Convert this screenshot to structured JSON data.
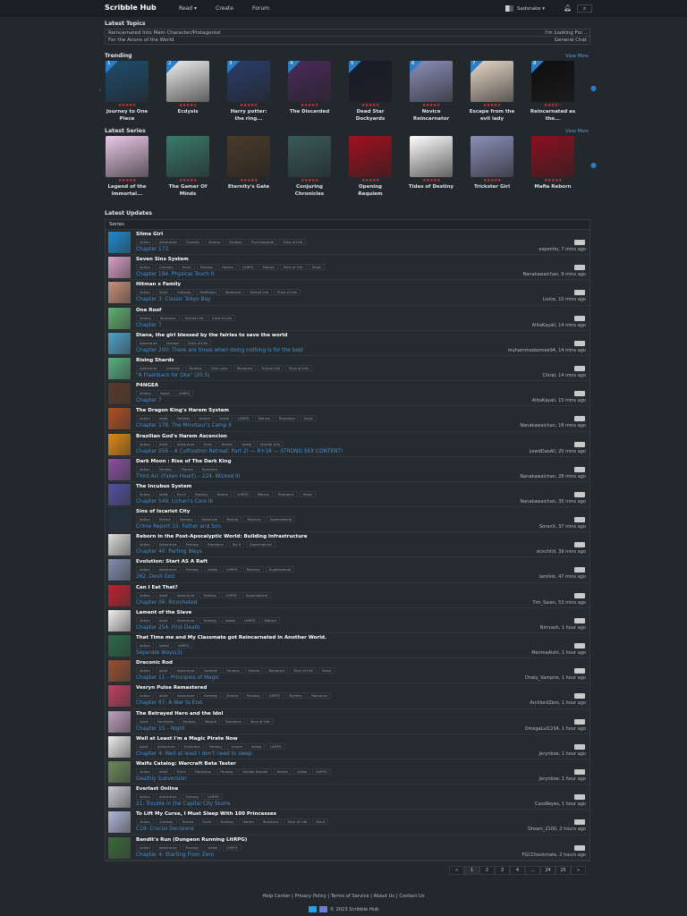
{
  "nav": {
    "brand": "Scribble Hub",
    "read": "Read ▾",
    "create": "Create",
    "forum": "Forum",
    "username": "Sadsnake ▾"
  },
  "latest_topics": {
    "label": "Latest Topics",
    "items": [
      {
        "title": "Reincarnated Into Main Character/Protagonist",
        "forum": "I'm Looking For..."
      },
      {
        "title": "For the Anons of the World",
        "forum": "General Chat"
      }
    ]
  },
  "trending": {
    "label": "Trending",
    "view_more": "View More",
    "items": [
      {
        "rank": "1",
        "title": "Journey to One Piece",
        "rating": 4.5
      },
      {
        "rank": "2",
        "title": "Ecdysis",
        "rating": 4.5
      },
      {
        "rank": "3",
        "title": "Harry potter: the ring...",
        "rating": 4.5
      },
      {
        "rank": "4",
        "title": "The Discarded",
        "rating": 4.5
      },
      {
        "rank": "5",
        "title": "Dead Star Dockyards",
        "rating": 4.5
      },
      {
        "rank": "6",
        "title": "Novice Reincarnator",
        "rating": 4.5
      },
      {
        "rank": "7",
        "title": "Escape from the evil lady",
        "rating": 4.5
      },
      {
        "rank": "8",
        "title": "Reincarnated as the...",
        "rating": 3.5
      }
    ]
  },
  "latest_series": {
    "label": "Latest Series",
    "view_more": "View More",
    "items": [
      {
        "title": "Legend of the Immortal...",
        "rating": 5
      },
      {
        "title": "The Gamer Of Minds",
        "rating": 5
      },
      {
        "title": "Eternity's Gate",
        "rating": 5
      },
      {
        "title": "Conjuring Chronicles",
        "rating": 5
      },
      {
        "title": "Opening Requiem",
        "rating": 5
      },
      {
        "title": "Tides of Destiny",
        "rating": 5
      },
      {
        "title": "Trickster Girl",
        "rating": 5
      },
      {
        "title": "Mafia Reborn",
        "rating": 5
      }
    ]
  },
  "updates": {
    "label": "Latest Updates",
    "header": "Series",
    "rows": [
      {
        "title": "Slime Girl",
        "tags": [
          "Action",
          "Adventure",
          "Comedy",
          "Drama",
          "Fantasy",
          "Psychological",
          "Slice of Life"
        ],
        "chapter": "Chapter 173",
        "meta": "expentio, 7 mins ago"
      },
      {
        "title": "Seven Sins System",
        "tags": [
          "Action",
          "Comedy",
          "Ecchi",
          "Fantasy",
          "Harem",
          "LitRPG",
          "Mature",
          "Slice of Life",
          "Smut"
        ],
        "chapter": "Chapter 194. Physical Touch II",
        "meta": "Nanakawaichan, 9 mins ago"
      },
      {
        "title": "Hitman x Family",
        "tags": [
          "Action",
          "Adult",
          "Comedy",
          "Fanfiction",
          "Romance",
          "School Life",
          "Slice of Life"
        ],
        "chapter": "Chapter 3: Classic Tokyo Bay",
        "meta": "Livice, 10 mins ago"
      },
      {
        "title": "One Roof",
        "tags": [
          "Drama",
          "Romance",
          "School Life",
          "Slice of Life"
        ],
        "chapter": "Chapter 7",
        "meta": "AlitaKayali, 14 mins ago"
      },
      {
        "title": "Diana, the girl blessed by the fairies to save the world",
        "tags": [
          "Adventure",
          "Fantasy",
          "Slice of Life"
        ],
        "chapter": "Chapter 200: There are times when doing nothing is for the best",
        "meta": "muhammadazmee94, 14 mins ago"
      },
      {
        "title": "Rising Shards",
        "tags": [
          "Adventure",
          "Comedy",
          "Fantasy",
          "Girls Love",
          "Romance",
          "School Life",
          "Slice of Life"
        ],
        "chapter": "\"A Flashback for Oka\" (20.5)",
        "meta": "Chiral, 14 mins ago"
      },
      {
        "title": "P4NGEA",
        "tags": [
          "Drama",
          "Isekai",
          "LitRPG"
        ],
        "chapter": "Chapter 7",
        "meta": "AlitaKayali, 15 mins ago"
      },
      {
        "title": "The Dragon King's Harem System",
        "tags": [
          "Action",
          "Adult",
          "Fantasy",
          "Harem",
          "Isekai",
          "LitRPG",
          "Mature",
          "Romance",
          "Smut"
        ],
        "chapter": "Chapter 178. The Minotaur's Camp II",
        "meta": "Nanakawaichan, 18 mins ago"
      },
      {
        "title": "Brazilian God's Harem Ascencion",
        "tags": [
          "Action",
          "Adult",
          "Adventure",
          "Ecchi",
          "Harem",
          "Isekai",
          "Martial Arts"
        ],
        "chapter": "Chapter 056 – A Cultivation Retreat: Part 2! — R+18 — STRONG SEX CONTENT!",
        "meta": "LewdDaoAll, 20 mins ago"
      },
      {
        "title": "Dark Moon : Rise of The Dark King",
        "tags": [
          "Action",
          "Fantasy",
          "Mature",
          "Romance"
        ],
        "chapter": "Third Arc (Fallen Heart) – 224. Wicked III",
        "meta": "Nanakawaichan, 28 mins ago"
      },
      {
        "title": "The Incubus System",
        "tags": [
          "Action",
          "Adult",
          "Ecchi",
          "Fantasy",
          "Harem",
          "LitRPG",
          "Mature",
          "Romance",
          "Smut"
        ],
        "chapter": "Chapter 549. Licheri's Core III",
        "meta": "Nanakawaichan, 35 mins ago"
      },
      {
        "title": "Sins of Iscariot City",
        "tags": [
          "Action",
          "Drama",
          "Fantasy",
          "Historical",
          "Mature",
          "Mystery",
          "Supernatural"
        ],
        "chapter": "Crime Report 15: Father and Son",
        "meta": "SoranX, 37 mins ago"
      },
      {
        "title": "Reborn in the Post-Apocalyptic World: Building Infrastructure",
        "tags": [
          "Action",
          "Adventure",
          "Fantasy",
          "Romance",
          "Sci-fi",
          "Supernatural"
        ],
        "chapter": "Chapter 40: Parting Ways",
        "meta": "sickchild, 39 mins ago"
      },
      {
        "title": "Evolution: Start AS A Raft",
        "tags": [
          "Action",
          "Adventure",
          "Fantasy",
          "Isekai",
          "LitRPG",
          "Mystery",
          "Supernatural"
        ],
        "chapter": "262. Devil God",
        "meta": "iamlink, 47 mins ago"
      },
      {
        "title": "Can I Eat That?",
        "tags": [
          "Action",
          "Adult",
          "Adventure",
          "Fantasy",
          "LitRPG",
          "Supernatural"
        ],
        "chapter": "Chapter 06: Ricocheted",
        "meta": "Tim_Saian, 53 mins ago"
      },
      {
        "title": "Lament of the Slave",
        "tags": [
          "Action",
          "Adult",
          "Adventure",
          "Fantasy",
          "Isekai",
          "LitRPG",
          "Mature"
        ],
        "chapter": "Chapter 254: First Death",
        "meta": "Nirrvash, 1 hour ago"
      },
      {
        "title": "That Time me and My Classmate got Reincarnated in Another World.",
        "tags": [
          "Action",
          "Isekai",
          "LitRPG"
        ],
        "chapter": "Separate Ways(3)",
        "meta": "MenmaAishi, 1 hour ago"
      },
      {
        "title": "Draconic Rod",
        "tags": [
          "Action",
          "Adult",
          "Adventure",
          "Comedy",
          "Fantasy",
          "Harem",
          "Romance",
          "Slice of Life",
          "Smut"
        ],
        "chapter": "Chapter 11 – Principles of Magic",
        "meta": "Draky_Vampire, 1 hour ago"
      },
      {
        "title": "Vesryn Pulse Remastered",
        "tags": [
          "Action",
          "Adult",
          "Adventure",
          "Comedy",
          "Drama",
          "Fantasy",
          "LitRPG",
          "Mystery",
          "Romance"
        ],
        "chapter": "Chapter 87: A War to End",
        "meta": "ArchlordZero, 1 hour ago"
      },
      {
        "title": "The Betrayed Hero and the Idol",
        "tags": [
          "Adult",
          "Fanfiction",
          "Fantasy",
          "Mature",
          "Romance",
          "Slice of Life"
        ],
        "chapter": "Chapter 15 – Night",
        "meta": "OmegaLul1234, 1 hour ago"
      },
      {
        "title": "Well at Least I'm a Magic Pirate Now",
        "tags": [
          "Adult",
          "Adventure",
          "Fanfiction",
          "Fantasy",
          "Harem",
          "Isekai",
          "LitRPG"
        ],
        "chapter": "Chapter 4: Well at least I don't need to sleep",
        "meta": "Jerynboe, 1 hour ago"
      },
      {
        "title": "Waifu Catalog: Warcraft Beta Tester",
        "tags": [
          "Action",
          "Adult",
          "Ecchi",
          "Fanfiction",
          "Fantasy",
          "Gender Bender",
          "Harem",
          "Isekai",
          "LitRPG"
        ],
        "chapter": "Deathly Subversion",
        "meta": "Jerynboe, 1 hour ago"
      },
      {
        "title": "Everlast Online",
        "tags": [
          "Action",
          "Adventure",
          "Fantasy",
          "LitRPG"
        ],
        "chapter": "21: Trouble in the Capital City Slums",
        "meta": "CassReyes, 1 hour ago"
      },
      {
        "title": "To Lift My Curse, I Must Sleep With 100 Princesses",
        "tags": [
          "Action",
          "Comedy",
          "Drama",
          "Ecchi",
          "Fantasy",
          "Harem",
          "Romance",
          "Slice of Life",
          "Smut"
        ],
        "chapter": "C19: Crucial Decisions",
        "meta": "Dream_2100, 2 hours ago"
      },
      {
        "title": "Bandit's Run (Dungeon Running LitRPG)",
        "tags": [
          "Action",
          "Adventure",
          "Fantasy",
          "Isekai",
          "LitRPG"
        ],
        "chapter": "Chapter 4: Starting From Zero",
        "meta": "FGCCheckmate, 2 hours ago"
      }
    ]
  },
  "pagination": {
    "prev": "«",
    "pages": [
      "1",
      "2",
      "3",
      "4",
      "...",
      "24",
      "25"
    ],
    "next": "»",
    "current": "1"
  },
  "footer": {
    "links": [
      "Help Center",
      "Privacy Policy",
      "Terms of Service",
      "About Us",
      "Contact Us"
    ],
    "copyright": "© 2023 Scribble Hub"
  }
}
